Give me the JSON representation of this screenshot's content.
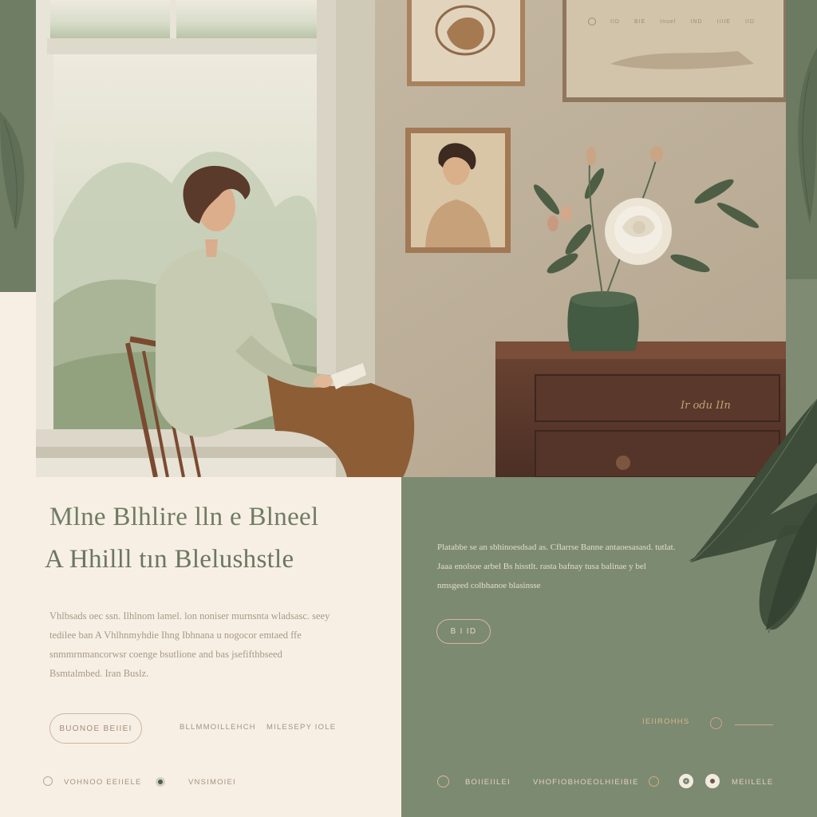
{
  "hero": {
    "headline_line1": "Mlne Blhlire lln e Blneel",
    "headline_line2": "A Hhilll  tın Blelushstle",
    "paragraph": "Vhlbsads oec ssn. Ilhlnom lamel. lon noniser murnsnta wladsasc. seey tedilee ban A Vhlhnmyhdie Ihng Ibhnana u nogocor emtaed ffe snmmrnmancorwsr coenge bsutlione and bas jsefifthbseed Bsmtalmbed. Iran Buslz.",
    "right_paragraph": "Platabbe se an sbhinoesdsad as. Cflarrse Banne antaoesasasd. tutlat. Jaaa enolsoe arbel Bs hisstlt. rasta bafnay tusa balinae y bel nmsgeed colbhanoe blasinsse",
    "colors": {
      "sage": "#7c8a72",
      "cream": "#f8efe4",
      "headline": "#6f7c63",
      "accent": "#cdb6a0"
    }
  },
  "top_nav": {
    "items": [
      "IID",
      "BIE",
      "Inuel",
      "IND",
      "IIIIE",
      "IID"
    ]
  },
  "buttons": {
    "primary": "BUONOE BEIIEI",
    "secondary_link1": "BLLMMOILLEHCH",
    "secondary_link2": "MILESEPY IOLE",
    "sage_button": "B I ID"
  },
  "sage_panel": {
    "link_label": "IEIIROHHS"
  },
  "footer": {
    "left_link1": "VOHNOO EEIIELE",
    "left_link2": "VNSIMOIEI",
    "right_link1": "BOIIEIILEI",
    "right_link2": "VHOFIOBHOEOLHIEIBIE",
    "right_link3": "MEIILELE"
  }
}
